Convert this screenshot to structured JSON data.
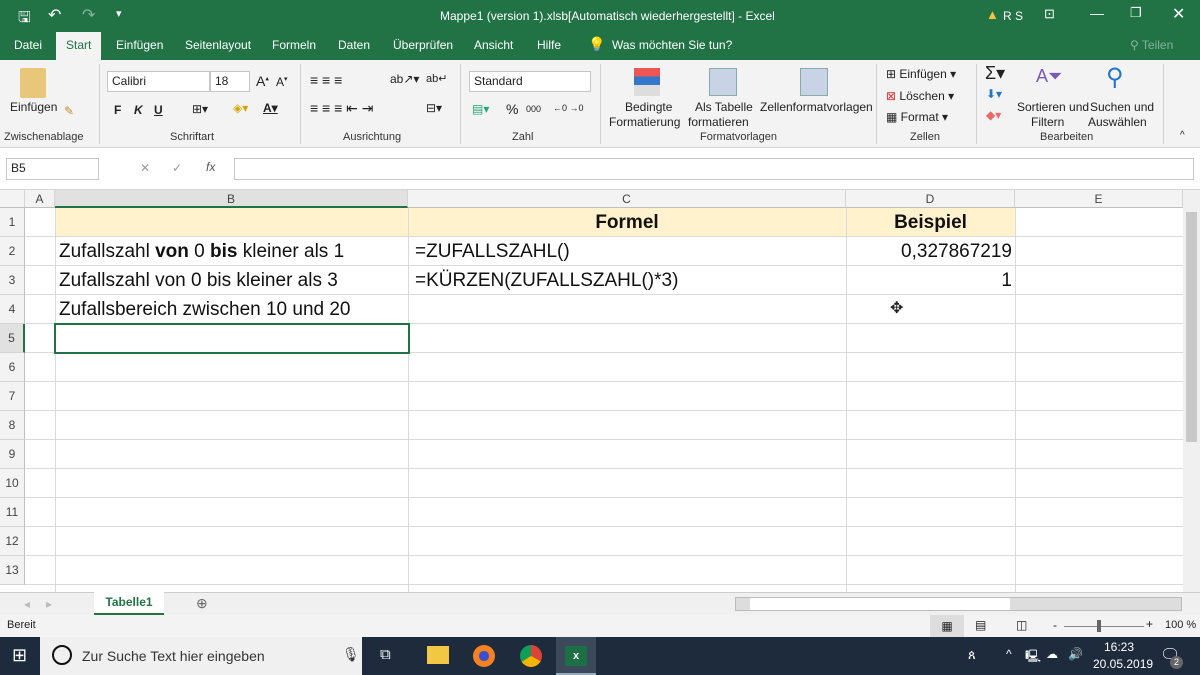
{
  "title_bar": {
    "title": "Mappe1 (version 1).xlsb[Automatisch wiederhergestellt]  -  Excel",
    "user": "R S"
  },
  "tabs": [
    "Datei",
    "Start",
    "Einfügen",
    "Seitenlayout",
    "Formeln",
    "Daten",
    "Überprüfen",
    "Ansicht",
    "Hilfe"
  ],
  "tell_me": "Was möchten Sie tun?",
  "share": "Teilen",
  "ribbon": {
    "paste": "Einfügen",
    "font_name": "Calibri",
    "font_size": "18",
    "bold": "F",
    "italic": "K",
    "underline": "U",
    "number_format": "Standard",
    "percent": "%",
    "thousands": "000",
    "cond_format": [
      "Bedingte",
      "Formatierung"
    ],
    "as_table": [
      "Als Tabelle",
      "formatieren"
    ],
    "cell_styles": "Zellenformatvorlagen",
    "insert": "Einfügen",
    "delete": "Löschen",
    "format": "Format",
    "sort": [
      "Sortieren und",
      "Filtern"
    ],
    "find": [
      "Suchen und",
      "Auswählen"
    ],
    "groups": [
      "Zwischenablage",
      "Schriftart",
      "Ausrichtung",
      "Zahl",
      "Formatvorlagen",
      "Zellen",
      "Bearbeiten"
    ]
  },
  "formula_bar": {
    "name_box": "B5",
    "fx": "fx",
    "content": ""
  },
  "columns": [
    "A",
    "B",
    "C",
    "D",
    "E"
  ],
  "rows": [
    "1",
    "2",
    "3",
    "4",
    "5",
    "6",
    "7",
    "8",
    "9",
    "10",
    "11",
    "12",
    "13"
  ],
  "cells": {
    "C1": "Formel",
    "D1": "Beispiel",
    "B2": [
      "Zufallszahl ",
      "von",
      " 0 ",
      "bis",
      " kleiner als 1"
    ],
    "C2": "=ZUFALLSZAHL()",
    "D2": "0,327867219",
    "B3": "Zufallszahl von 0 bis kleiner als 3",
    "C3": "=KÜRZEN(ZUFALLSZAHL()*3)",
    "D3": "1",
    "B4": "Zufallsbereich zwischen 10 und 20"
  },
  "header_fill": "#fff2cc",
  "sheet_tab": "Tabelle1",
  "status": {
    "ready": "Bereit",
    "zoom": "100 %"
  },
  "taskbar": {
    "search": "Zur Suche Text hier eingeben",
    "time": "16:23",
    "date": "20.05.2019",
    "notifications": "2"
  }
}
